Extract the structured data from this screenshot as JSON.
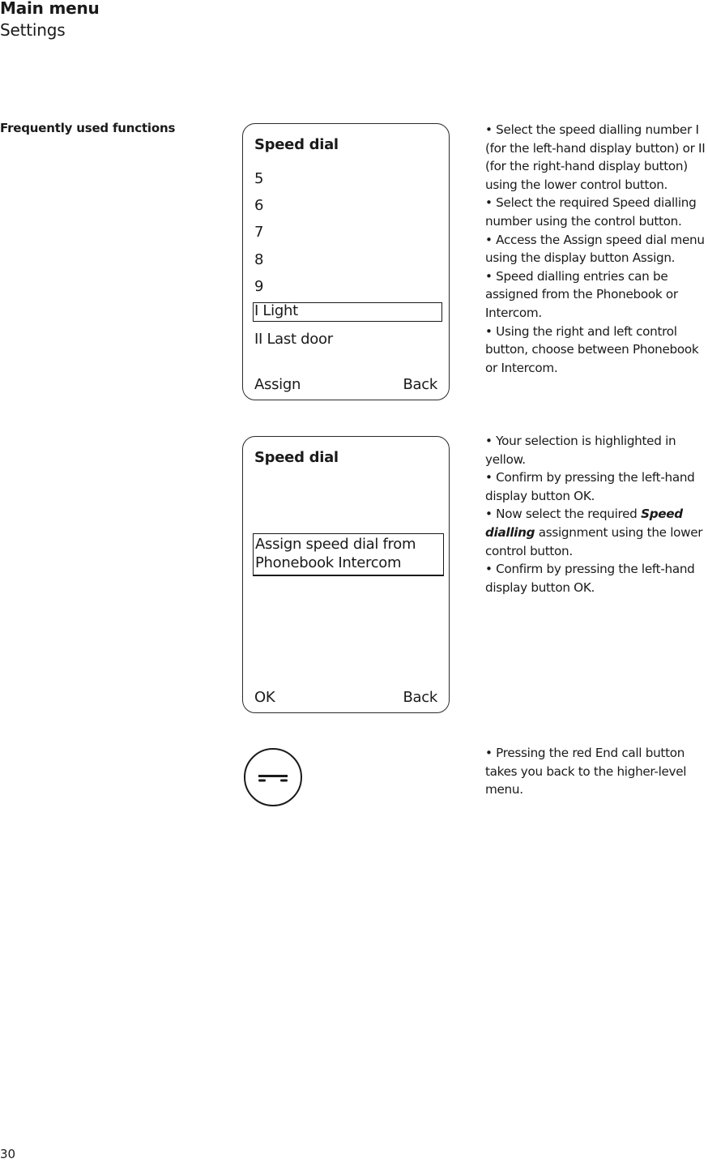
{
  "header": {
    "title": "Main menu",
    "subtitle": "Settings"
  },
  "section_label": "Frequently used functions",
  "screen1": {
    "title": "Speed dial",
    "items": [
      "5",
      "6",
      "7",
      "8",
      "9"
    ],
    "selected_item": "I Light",
    "after_item": "II Last door",
    "soft_left": "Assign",
    "soft_right": "Back"
  },
  "screen2": {
    "title": "Speed dial",
    "selected_line1": "Assign speed dial from",
    "selected_line2": "Phonebook  Intercom",
    "soft_left": "OK",
    "soft_right": "Back"
  },
  "desc1": [
    "• Select the speed dialling number I (for the left-hand display button) or II (for the right-hand display button) using the lower control button.",
    "• Select the required Speed dialling number using the control button.",
    "• Access the Assign speed dial menu using the display button Assign.",
    "• Speed dialling entries can be assigned from the Phonebook or Intercom.",
    "• Using the right and left control button, choose between Phonebook or Intercom."
  ],
  "desc2": {
    "p1": "• Your selection is highlighted in yellow.",
    "p2": "• Confirm by pressing the left-hand display button OK.",
    "p3_pre": "• Now select the required ",
    "p3_bold": "Speed dialling",
    "p3_post": " assignment using the lower control button.",
    "p4": "• Confirm by pressing the left-hand display button OK."
  },
  "desc3": "• Pressing the red End call button takes you back to the higher-level menu.",
  "icons": {
    "end_call": "end-call-icon"
  },
  "page_number": "30"
}
